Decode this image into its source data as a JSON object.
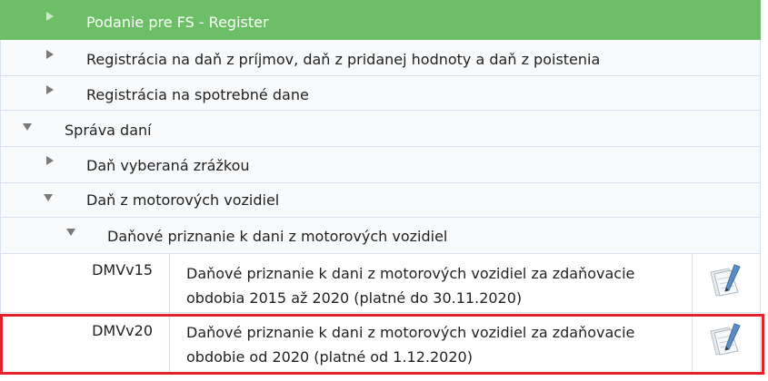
{
  "tree": {
    "items": [
      {
        "label": "Podanie pre FS - Register",
        "state": "collapsed",
        "active": true
      },
      {
        "label": "Registrácia na daň z príjmov, daň z pridanej hodnoty a daň z poistenia",
        "state": "collapsed"
      },
      {
        "label": "Registrácia na spotrebné dane",
        "state": "collapsed"
      },
      {
        "label": "Správa daní",
        "state": "expanded"
      },
      {
        "label": "Daň vyberaná zrážkou",
        "state": "collapsed"
      },
      {
        "label": "Daň z motorových vozidiel",
        "state": "expanded"
      },
      {
        "label": "Daňové priznanie k dani z motorových vozidiel",
        "state": "expanded"
      }
    ]
  },
  "forms": [
    {
      "code": "DMVv15",
      "description": "Daňové priznanie k dani z motorových vozidiel za zdaňovacie obdobia 2015 až 2020 (platné do 30.11.2020)",
      "icon": "form-document-icon"
    },
    {
      "code": "DMVv20",
      "description": "Daňové priznanie k dani z motorových vozidiel za zdaňovacie obdobie od 2020 (platné od 1.12.2020)",
      "icon": "form-document-icon",
      "highlighted": true
    }
  ],
  "colors": {
    "active_row": "#6dbf67",
    "highlight_border": "#e3222a",
    "row_border": "#d9e3ef"
  }
}
